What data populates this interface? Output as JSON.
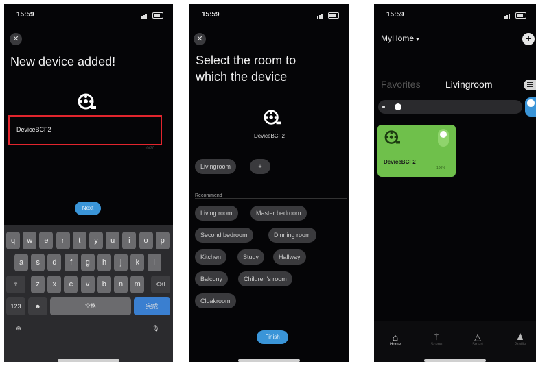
{
  "screen1": {
    "time": "15:59",
    "title": "New device added!",
    "device_name": "DeviceBCF2",
    "char_count": "10/20",
    "next_label": "Next",
    "keyboard": {
      "row1": [
        "q",
        "w",
        "e",
        "r",
        "t",
        "y",
        "u",
        "i",
        "o",
        "p"
      ],
      "row2": [
        "a",
        "s",
        "d",
        "f",
        "g",
        "h",
        "j",
        "k",
        "l"
      ],
      "row3": [
        "z",
        "x",
        "c",
        "v",
        "b",
        "n",
        "m"
      ],
      "numbers_key": "123",
      "space_key": "空格",
      "done_key": "完成"
    }
  },
  "screen2": {
    "time": "15:59",
    "title_line1": "Select the room to",
    "title_line2": "which the device",
    "device_name": "DeviceBCF2",
    "current_room": "Livingroom",
    "add_label": "+",
    "recommend_label": "Recommend",
    "rooms": [
      "Living room",
      "Master bedroom",
      "Second bedroom",
      "Dinning room",
      "Kitchen",
      "Study",
      "Hallway",
      "Balcony",
      "Children's room",
      "Cloakroom"
    ],
    "finish_label": "Finish"
  },
  "screen3": {
    "time": "15:59",
    "home_name": "MyHome",
    "tab_favorites": "Favorites",
    "tab_livingroom": "Livingroom",
    "device_name": "DeviceBCF2",
    "device_status": "100%",
    "nav": [
      "Home",
      "Scene",
      "Smart",
      "Profile"
    ],
    "accent_color": "#6fc04b"
  }
}
